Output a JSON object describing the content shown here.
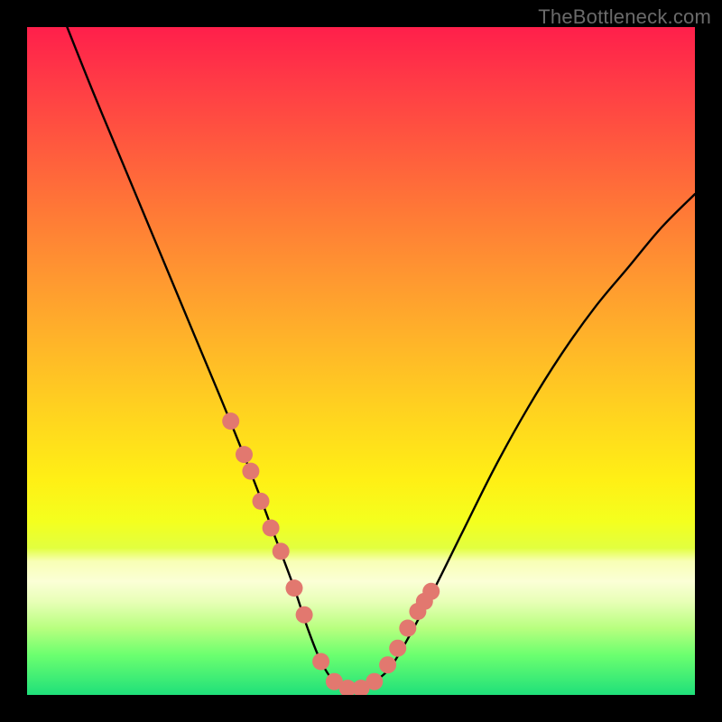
{
  "watermark": "TheBottleneck.com",
  "colors": {
    "frame": "#000000",
    "curve": "#000000",
    "marker_fill": "#e2786f",
    "marker_stroke": "#d46a61"
  },
  "chart_data": {
    "type": "line",
    "title": "",
    "xlabel": "",
    "ylabel": "",
    "xlim": [
      0,
      100
    ],
    "ylim": [
      0,
      100
    ],
    "grid": false,
    "legend": false,
    "series": [
      {
        "name": "bottleneck-curve",
        "x": [
          6,
          10,
          15,
          20,
          25,
          30,
          34,
          37,
          40,
          42,
          44,
          46,
          48,
          50,
          52,
          55,
          60,
          65,
          70,
          75,
          80,
          85,
          90,
          95,
          100
        ],
        "values": [
          100,
          90,
          78,
          66,
          54,
          42,
          32,
          24,
          16,
          10,
          5,
          2,
          1,
          1,
          2,
          5,
          14,
          24,
          34,
          43,
          51,
          58,
          64,
          70,
          75
        ]
      }
    ],
    "markers": {
      "name": "highlighted-points",
      "x": [
        30.5,
        32.5,
        33.5,
        35.0,
        36.5,
        38.0,
        40.0,
        41.5,
        44.0,
        46.0,
        48.0,
        50.0,
        52.0,
        54.0,
        55.5,
        57.0,
        58.5,
        59.5,
        60.5
      ],
      "values": [
        41.0,
        36.0,
        33.5,
        29.0,
        25.0,
        21.5,
        16.0,
        12.0,
        5.0,
        2.0,
        1.0,
        1.0,
        2.0,
        4.5,
        7.0,
        10.0,
        12.5,
        14.0,
        15.5
      ]
    }
  }
}
